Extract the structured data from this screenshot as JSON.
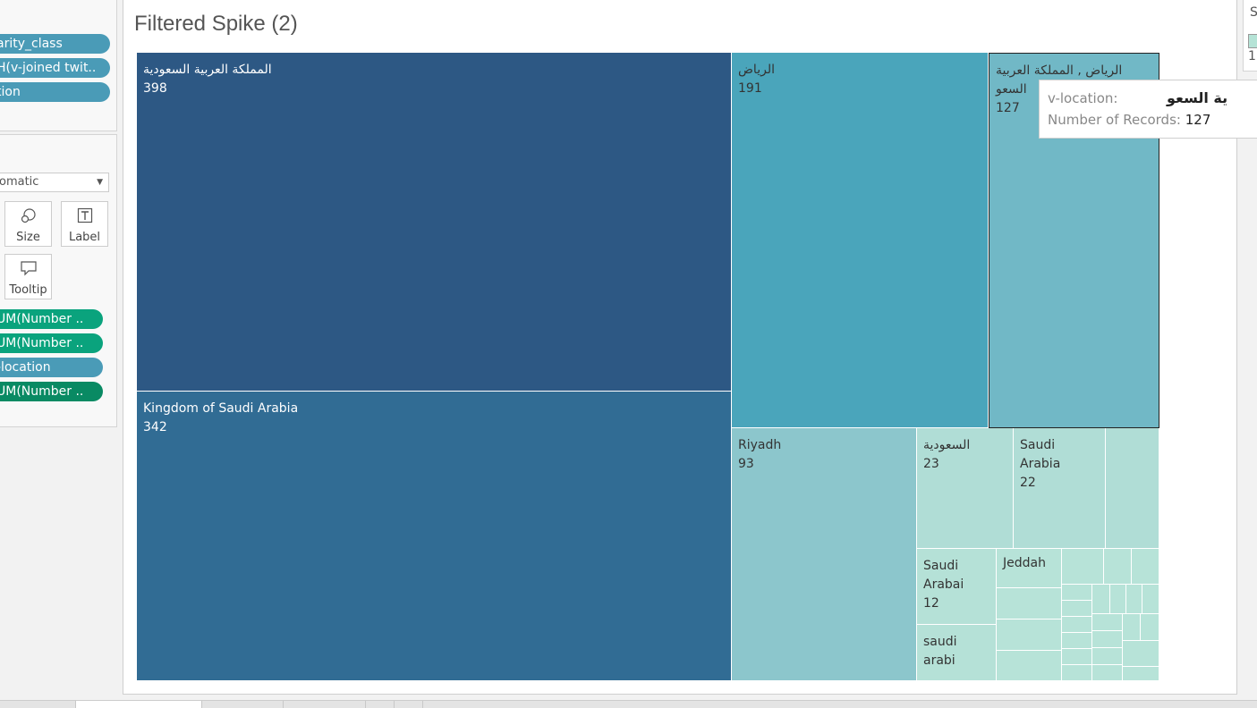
{
  "shelves": {
    "top_pills": [
      "arity_class",
      "H(v-joined twit..",
      "tion"
    ],
    "mark_type": "omatic",
    "mark_buttons": [
      "Size",
      "Label",
      "Tooltip"
    ],
    "mark_pills": [
      "UM(Number ..",
      "UM(Number ..",
      "-location",
      "UM(Number .."
    ]
  },
  "view": {
    "title": "Filtered Spike (2)"
  },
  "chart_data": {
    "type": "treemap",
    "title": "Filtered Spike (2)",
    "measure": "Number of Records",
    "dimension": "v-location",
    "items": [
      {
        "label": "المملكة العربية السعودية",
        "value": 398
      },
      {
        "label": "Kingdom of Saudi Arabia",
        "value": 342
      },
      {
        "label": "الرياض",
        "value": 191
      },
      {
        "label": "الرياض , المملكة العربية السعو",
        "value": 127
      },
      {
        "label": "Riyadh",
        "value": 93
      },
      {
        "label": "السعودية",
        "value": 23
      },
      {
        "label": "Saudi Arabia",
        "value": 22
      },
      {
        "label": "Saudi Arabai",
        "value": 12
      },
      {
        "label": "Jeddah"
      },
      {
        "label": "saudi arabi"
      }
    ],
    "colors": {
      "darkest": "#2d5884",
      "dark": "#316c94",
      "mid": "#4aa5bb",
      "mid_light": "#71b8c6",
      "light": "#8cc6cc",
      "pale": "#b0ddd6",
      "palest": "#b7e3d8"
    }
  },
  "cells": {
    "c1": {
      "name": "المملكة العربية السعودية",
      "value": "398"
    },
    "c2": {
      "name": "Kingdom of Saudi Arabia",
      "value": "342"
    },
    "c3": {
      "name": "الرياض",
      "value": "191"
    },
    "c4": {
      "line1": "الرياض , المملكة العربية",
      "line2": "السعو",
      "value": "127"
    },
    "c5": {
      "name": "Riyadh",
      "value": "93"
    },
    "c6": {
      "name": "السعودية",
      "value": "23"
    },
    "c7": {
      "line1": "Saudi",
      "line2": "Arabia",
      "value": "22"
    },
    "c8": {
      "line1": "Saudi",
      "line2": "Arabai",
      "value": "12"
    },
    "c9": {
      "name": "Jeddah"
    },
    "c10": {
      "line1": "saudi",
      "line2": "arabi"
    }
  },
  "tooltip": {
    "field1_label": "v-location:",
    "field1_value": "ية السعو",
    "field2_label": "Number of Records:",
    "field2_value": "127"
  },
  "legend": {
    "header": "S",
    "value": "1"
  }
}
